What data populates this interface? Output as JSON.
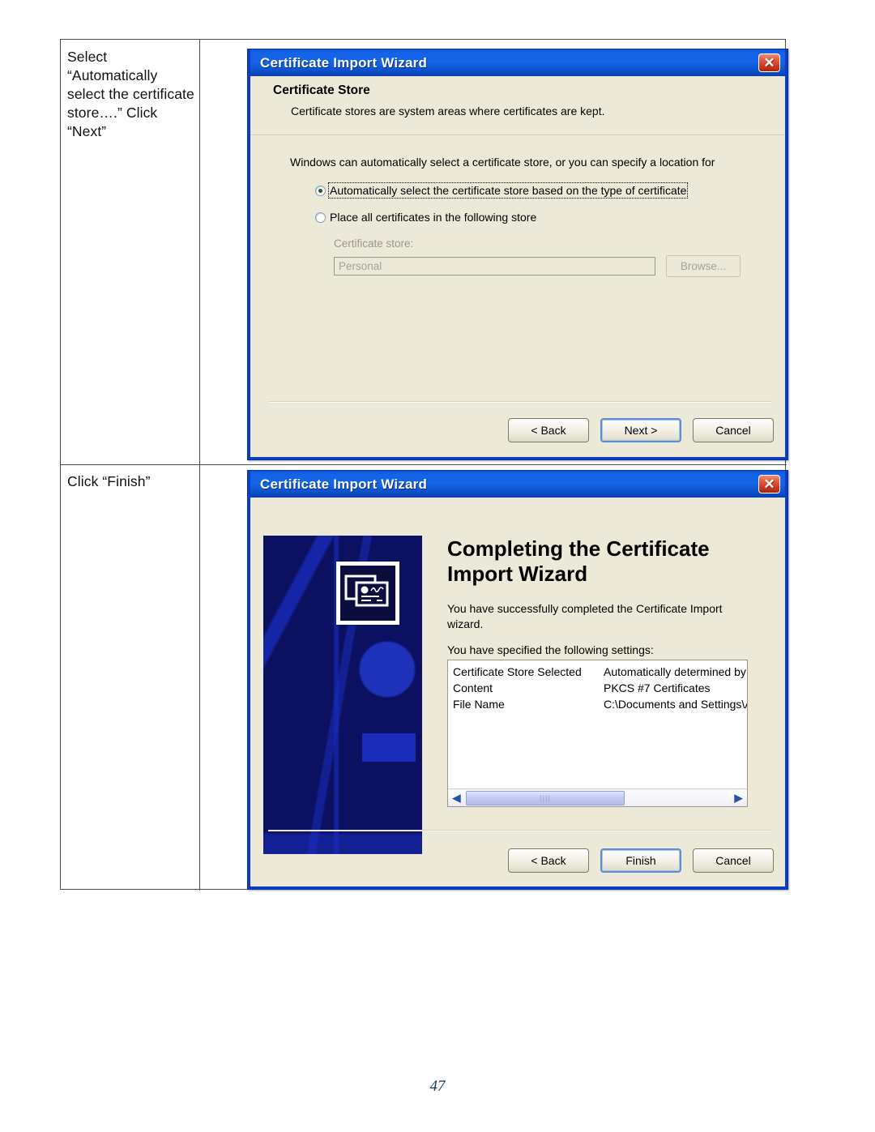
{
  "document": {
    "page_number": "47",
    "rows": [
      {
        "instruction": "Select “Automatically select the certificate store….”  Click “Next”"
      },
      {
        "instruction": "Click “Finish”"
      }
    ]
  },
  "dialog_one": {
    "title": "Certificate Import Wizard",
    "close_icon": "close-icon",
    "header": {
      "title": "Certificate Store",
      "subtitle": "Certificate stores are system areas where certificates are kept."
    },
    "body_text": "Windows can automatically select a certificate store, or you can specify a location for",
    "radio_options": [
      {
        "label": "Automatically select the certificate store based on the type of certificate",
        "selected": true,
        "focused": true
      },
      {
        "label": "Place all certificates in the following store",
        "selected": false,
        "focused": false
      }
    ],
    "store_field": {
      "label": "Certificate store:",
      "value": "Personal",
      "browse_label": "Browse..."
    },
    "buttons": [
      {
        "label": "< Back",
        "default": false
      },
      {
        "label": "Next >",
        "default": true
      },
      {
        "label": "Cancel",
        "default": false
      }
    ]
  },
  "dialog_two": {
    "title": "Certificate Import Wizard",
    "close_icon": "close-icon",
    "watermark_icon": "certificate-icon",
    "welcome_title": "Completing the Certificate Import Wizard",
    "paragraph_one": "You have successfully completed the Certificate Import wizard.",
    "paragraph_two": "You have specified the following settings:",
    "settings": [
      {
        "key": "Certificate Store Selected",
        "value": "Automatically determined by t"
      },
      {
        "key": "Content",
        "value": "PKCS #7 Certificates"
      },
      {
        "key": "File Name",
        "value": "C:\\Documents and Settings\\A"
      }
    ],
    "scrollbar": {
      "left_arrow": "◀",
      "right_arrow": "▶",
      "thumb_grip": "||||"
    },
    "buttons": [
      {
        "label": "< Back",
        "default": false
      },
      {
        "label": "Finish",
        "default": true
      },
      {
        "label": "Cancel",
        "default": false
      }
    ]
  },
  "colors": {
    "titlebar_blue": "#1565e6",
    "dialog_face": "#ece9d8",
    "close_red": "#c8341c",
    "watermark_navy": "#0b1160",
    "page_number_navy": "#1f3864"
  }
}
